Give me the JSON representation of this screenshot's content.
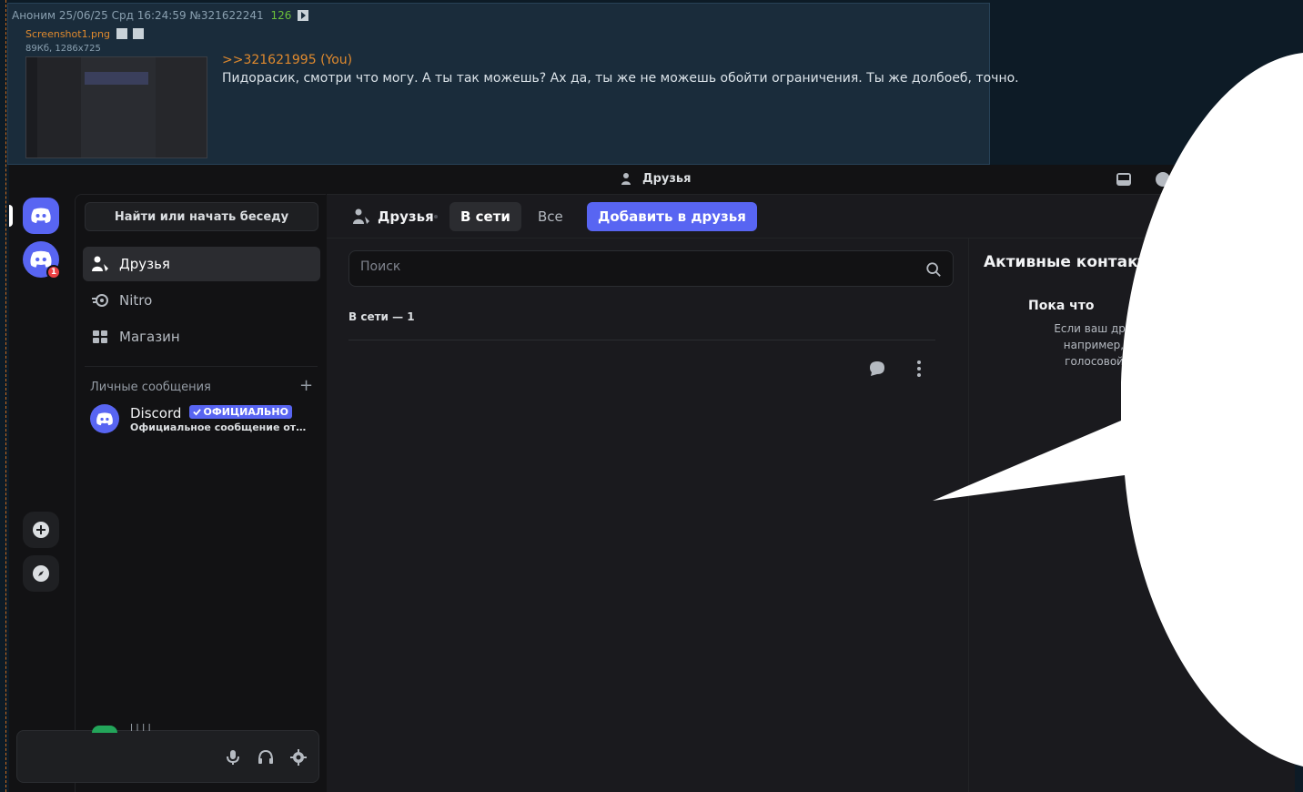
{
  "post": {
    "header": "Аноним 25/06/25 Срд 16:24:59 №321622241",
    "count": "126",
    "file_name": "Screenshot1.png",
    "file_meta": "89Кб, 1286x725",
    "reply_link": ">>321621995 (You)",
    "text": "Пидорасик, смотри что могу. А ты так можешь? Ах да, ты же не можешь обойти ограничения. Ты же долбоеб, точно."
  },
  "discord": {
    "window_title": "Друзья",
    "search_conversation": "Найти или начать беседу",
    "nav": {
      "friends": "Друзья",
      "nitro": "Nitro",
      "shop": "Магазин"
    },
    "dm_header": "Личные сообщения",
    "dm_add": "+",
    "dm": {
      "name": "Discord",
      "badge": "ОФИЦИАЛЬНО",
      "subtitle": "Официальное сообщение от Disco..."
    },
    "guild_badge": "1",
    "user_panel": {
      "name": "l l l l"
    },
    "topbar": {
      "friends": "Друзья",
      "tab_online": "В сети",
      "tab_all": "Все",
      "add_friend": "Добавить в друзья"
    },
    "search_placeholder": "Поиск",
    "online_count": "В сети — 1",
    "active_panel": {
      "title": "Активные контакты",
      "empty_title": "Пока что",
      "empty_text_1": "Если ваш друг начнё",
      "empty_text_2": "например, запуст",
      "empty_text_3": "голосовой чат, —"
    }
  },
  "colors": {
    "discord_blurple": "#5865f2",
    "board_bg": "#0d1b26",
    "post_bg": "#1a2c3b",
    "link_orange": "#e08a2e",
    "count_green": "#6bbf3a"
  }
}
